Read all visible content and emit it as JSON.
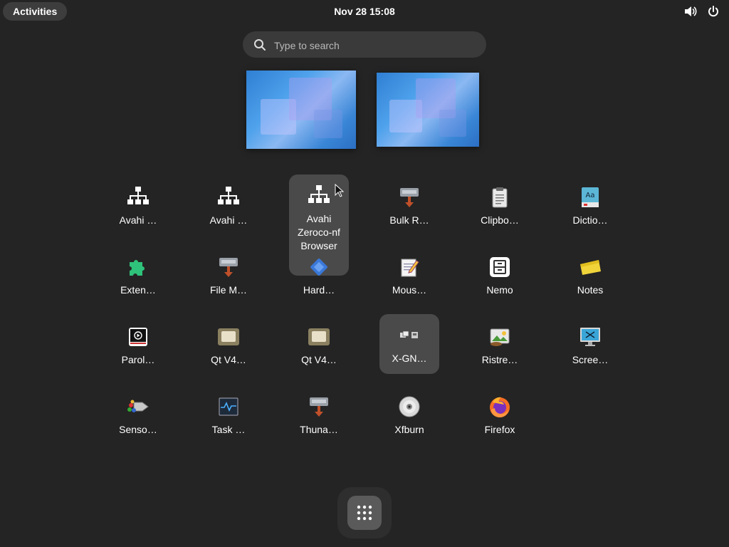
{
  "topbar": {
    "activities": "Activities",
    "clock": "Nov 28  15:08",
    "icons": [
      "volume-icon",
      "power-icon"
    ]
  },
  "search": {
    "placeholder": "Type to search",
    "value": ""
  },
  "apps": [
    {
      "label": "Avahi …",
      "icon": "network-icon"
    },
    {
      "label": "Avahi …",
      "icon": "network-icon"
    },
    {
      "label": "Avahi Zeroco-nf Browser",
      "icon": "network-icon"
    },
    {
      "label": "Bulk R…",
      "icon": "hdd-icon"
    },
    {
      "label": "Clipbo…",
      "icon": "clipboard-icon"
    },
    {
      "label": "Dictio…",
      "icon": "dictionary-icon"
    },
    {
      "label": "Exten…",
      "icon": "puzzle-icon"
    },
    {
      "label": "File M…",
      "icon": "hdd-icon"
    },
    {
      "label": "Hard…",
      "icon": "chip-icon"
    },
    {
      "label": "Mous…",
      "icon": "notepad-icon"
    },
    {
      "label": "Nemo",
      "icon": "cabinet-icon"
    },
    {
      "label": "Notes",
      "icon": "sticky-note-icon"
    },
    {
      "label": "Parol…",
      "icon": "media-player-icon"
    },
    {
      "label": "Qt V4…",
      "icon": "qt-icon"
    },
    {
      "label": "Qt V4…",
      "icon": "qt-icon"
    },
    {
      "label": "X-GN…",
      "icon": "xgnome-icon"
    },
    {
      "label": "Ristre…",
      "icon": "image-viewer-icon"
    },
    {
      "label": "Scree…",
      "icon": "screenshot-icon"
    },
    {
      "label": "Senso…",
      "icon": "sensors-icon"
    },
    {
      "label": "Task …",
      "icon": "task-manager-icon"
    },
    {
      "label": "Thuna…",
      "icon": "hdd-icon"
    },
    {
      "label": "Xfburn",
      "icon": "disc-icon"
    },
    {
      "label": "Firefox",
      "icon": "firefox-icon"
    }
  ],
  "dock": {
    "icon": "app-grid-icon"
  },
  "colors": {
    "background": "#242424",
    "highlight": "#4a4a4a",
    "search": "#3a3a3a"
  }
}
